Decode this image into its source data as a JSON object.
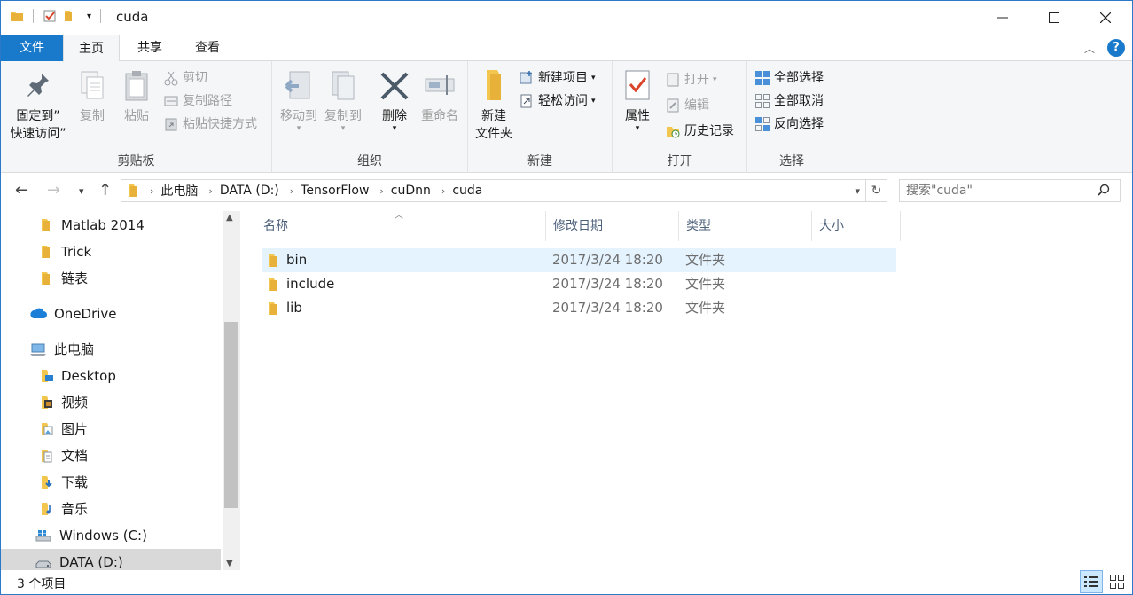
{
  "window": {
    "title": "cuda"
  },
  "ribbon_tabs": {
    "file": "文件",
    "home": "主页",
    "share": "共享",
    "view": "查看"
  },
  "ribbon": {
    "clipboard": {
      "label": "剪贴板",
      "pin_line1": "固定到”",
      "pin_line2": "快速访问”",
      "copy": "复制",
      "paste": "粘贴",
      "cut": "剪切",
      "copy_path": "复制路径",
      "paste_shortcut": "粘贴快捷方式"
    },
    "organize": {
      "label": "组织",
      "move_to": "移动到",
      "copy_to": "复制到",
      "delete": "删除",
      "rename": "重命名"
    },
    "new": {
      "label": "新建",
      "new_folder_line1": "新建",
      "new_folder_line2": "文件夹",
      "new_item": "新建项目",
      "easy_access": "轻松访问"
    },
    "open": {
      "label": "打开",
      "properties": "属性",
      "open": "打开",
      "edit": "编辑",
      "history": "历史记录"
    },
    "select": {
      "label": "选择",
      "select_all": "全部选择",
      "select_none": "全部取消",
      "invert": "反向选择"
    }
  },
  "address": {
    "breadcrumbs": [
      "此电脑",
      "DATA (D:)",
      "TensorFlow",
      "cuDnn",
      "cuda"
    ]
  },
  "search": {
    "placeholder": "搜索\"cuda\""
  },
  "nav_tree": [
    {
      "label": "Matlab 2014",
      "icon": "folder-icon"
    },
    {
      "label": "Trick",
      "icon": "folder-icon"
    },
    {
      "label": "链表",
      "icon": "folder-icon"
    },
    {
      "label": "OneDrive",
      "icon": "cloud-icon"
    },
    {
      "label": "此电脑",
      "icon": "computer-icon"
    },
    {
      "label": "Desktop",
      "icon": "desktop-folder-icon"
    },
    {
      "label": "视频",
      "icon": "video-folder-icon"
    },
    {
      "label": "图片",
      "icon": "pictures-folder-icon"
    },
    {
      "label": "文档",
      "icon": "documents-folder-icon"
    },
    {
      "label": "下载",
      "icon": "downloads-folder-icon"
    },
    {
      "label": "音乐",
      "icon": "music-folder-icon"
    },
    {
      "label": "Windows (C:)",
      "icon": "windows-drive-icon"
    },
    {
      "label": "DATA (D:)",
      "icon": "drive-icon"
    }
  ],
  "columns": {
    "name": "名称",
    "date": "修改日期",
    "type": "类型",
    "size": "大小"
  },
  "files": [
    {
      "name": "bin",
      "date": "2017/3/24 18:20",
      "type": "文件夹"
    },
    {
      "name": "include",
      "date": "2017/3/24 18:20",
      "type": "文件夹"
    },
    {
      "name": "lib",
      "date": "2017/3/24 18:20",
      "type": "文件夹"
    }
  ],
  "status": {
    "count_text": "3 个项目"
  },
  "colors": {
    "accent": "#1979ca",
    "folder": "#f3c74f",
    "hover_row": "#e5f3ff"
  }
}
